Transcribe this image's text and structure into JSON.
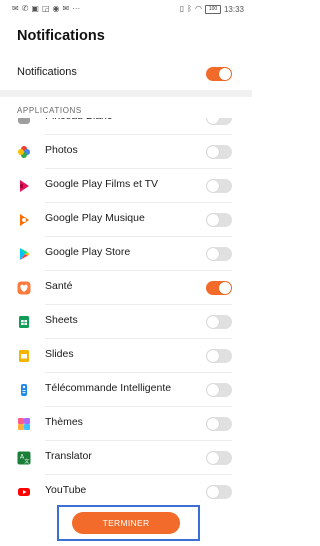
{
  "status_bar": {
    "time": "13:33",
    "battery": "100",
    "left_icons": [
      "mail-icon",
      "call-icon",
      "image-icon",
      "cast-icon",
      "whatsapp-icon",
      "mail-icon",
      "more-icon"
    ],
    "right_icons": [
      "vibrate-icon",
      "bluetooth-icon",
      "wifi-icon"
    ]
  },
  "page": {
    "title": "Notifications"
  },
  "master": {
    "label": "Notifications",
    "enabled": true
  },
  "section": {
    "header": "APPLICATIONS"
  },
  "apps": [
    {
      "label": "Pinceau Blanc",
      "enabled": false,
      "icon": "app-icon"
    },
    {
      "label": "Photos",
      "enabled": false,
      "icon": "photos-icon"
    },
    {
      "label": "Google Play Films et TV",
      "enabled": false,
      "icon": "play-movies-icon"
    },
    {
      "label": "Google Play Musique",
      "enabled": false,
      "icon": "play-music-icon"
    },
    {
      "label": "Google Play Store",
      "enabled": false,
      "icon": "play-store-icon"
    },
    {
      "label": "Santé",
      "enabled": true,
      "icon": "health-icon"
    },
    {
      "label": "Sheets",
      "enabled": false,
      "icon": "sheets-icon"
    },
    {
      "label": "Slides",
      "enabled": false,
      "icon": "slides-icon"
    },
    {
      "label": "Télécommande Intelligente",
      "enabled": false,
      "icon": "remote-icon"
    },
    {
      "label": "Thèmes",
      "enabled": false,
      "icon": "themes-icon"
    },
    {
      "label": "Translator",
      "enabled": false,
      "icon": "translator-icon"
    },
    {
      "label": "YouTube",
      "enabled": false,
      "icon": "youtube-icon"
    }
  ],
  "footer": {
    "button_label": "TERMINER"
  },
  "colors": {
    "accent": "#f26b2b",
    "toggle_off": "#e0e0e0",
    "focus": "#3c6fd4"
  }
}
